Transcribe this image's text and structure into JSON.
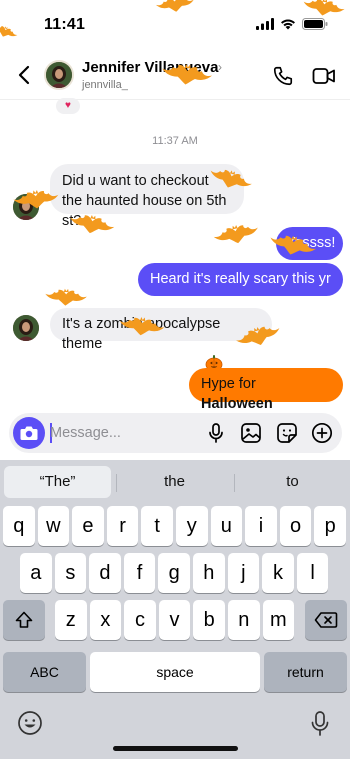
{
  "status": {
    "time": "11:41"
  },
  "header": {
    "contact_name": "Jennifer Villanueva",
    "username": "jennvilla_",
    "back_icon": "chevron-left-icon",
    "call_icon": "phone-icon",
    "video_icon": "video-camera-icon"
  },
  "chat": {
    "reaction": "♥",
    "timestamp": "11:37 AM",
    "messages": [
      {
        "from": "contact",
        "text": "Did u want to checkout the haunted house on 5th st?"
      },
      {
        "from": "me",
        "text": "Yessss!"
      },
      {
        "from": "me",
        "text": "Heard it's really scary this yr"
      },
      {
        "from": "contact",
        "text": "It's a zombie apocalypse theme"
      },
      {
        "from": "me",
        "text_before": "Hype for ",
        "text_bold": "Halloween"
      }
    ],
    "effect": "halloween-bats",
    "colors": {
      "accent": "#5b4ef6",
      "halloween": "#ff7a00",
      "bat": "#f39a1e"
    }
  },
  "composer": {
    "placeholder": "Message...",
    "icons": [
      "camera-icon",
      "microphone-icon",
      "image-icon",
      "sticker-icon",
      "add-icon"
    ]
  },
  "keyboard": {
    "suggestions": [
      "“The”",
      "the",
      "to"
    ],
    "row1": [
      "q",
      "w",
      "e",
      "r",
      "t",
      "y",
      "u",
      "i",
      "o",
      "p"
    ],
    "row2": [
      "a",
      "s",
      "d",
      "f",
      "g",
      "h",
      "j",
      "k",
      "l"
    ],
    "row3": [
      "z",
      "x",
      "c",
      "v",
      "b",
      "n",
      "m"
    ],
    "abc_label": "ABC",
    "space_label": "space",
    "return_label": "return"
  }
}
